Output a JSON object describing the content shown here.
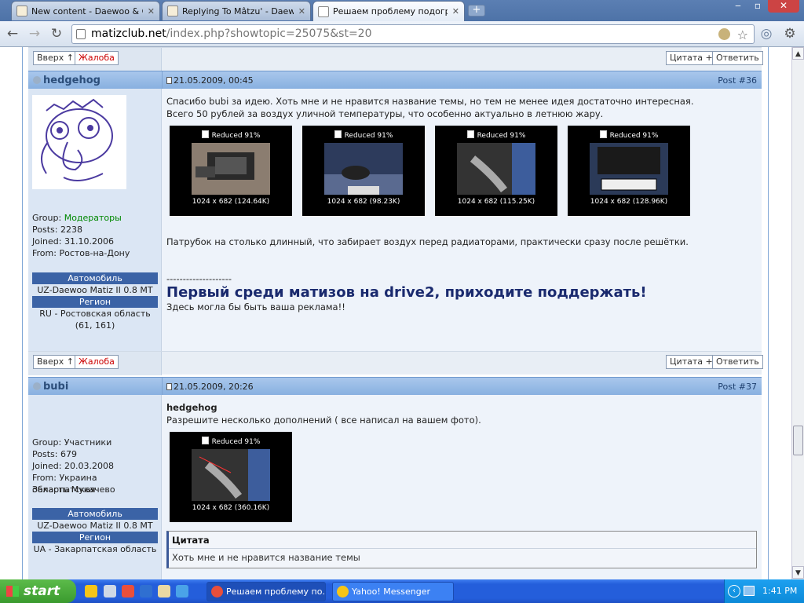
{
  "browser": {
    "tabs": [
      {
        "title": "New content - Daewoo & C..."
      },
      {
        "title": "Replying To Mâtzu' - Daew..."
      },
      {
        "title": "Решаем проблему подогр..."
      }
    ],
    "new_tab": "+",
    "url_host": "matizclub.net",
    "url_path": "/index.php?showtopic=25075&st=20",
    "window": {
      "minimize": "‒",
      "maximize": "▫",
      "close": "✕"
    }
  },
  "buttons": {
    "top": "Вверх ↑",
    "complain": "Жалоба",
    "quote": "Цитата +",
    "reply": "Ответить"
  },
  "post1": {
    "author": "hedgehog",
    "date": "21.05.2009, 00:45",
    "number": "Post #36",
    "group_label": "Group:",
    "group": "Модераторы",
    "posts": "Posts: 2238",
    "joined": "Joined: 31.10.2006",
    "from": "From: Ростов-на-Дону",
    "car_head": "Автомобиль",
    "car": "UZ-Daewoo Matiz II 0.8 MT",
    "region_head": "Регион",
    "region": "RU - Ростовская область (61, 161)",
    "text1": "Спасибо bubi за идею. Хоть мне и не нравится название темы, но тем не менее идея достаточно интересная.",
    "text2": "Всего 50 рублей за воздух уличной температуры, что особенно актуально в летнюю жару.",
    "thumbs": [
      {
        "caption": "Reduced 91%",
        "size": "1024 x 682 (124.64K)"
      },
      {
        "caption": "Reduced 91%",
        "size": "1024 x 682 (98.23K)"
      },
      {
        "caption": "Reduced 91%",
        "size": "1024 x 682 (115.25K)"
      },
      {
        "caption": "Reduced 91%",
        "size": "1024 x 682 (128.96K)"
      }
    ],
    "text3": "Патрубок на столько длинный, что забирает воздух перед радиаторами, практически сразу после решётки.",
    "sig_divider": "--------------------",
    "sig_title": "Первый среди матизов на drive2, приходите поддержать!",
    "sig_text": "Здесь могла бы быть ваша реклама!!"
  },
  "post2": {
    "author": "bubi",
    "date": "21.05.2009, 20:26",
    "number": "Post #37",
    "group": "Group: Участники",
    "posts": "Posts: 679",
    "joined": "Joined: 20.03.2008",
    "from1": "From: Украина Закарпатская",
    "from2": "область Мукачево",
    "car_head": "Автомобиль",
    "car": "UZ-Daewoo Matiz II 0.8 MT",
    "region_head": "Регион",
    "region": "UA - Закарпатская область",
    "addressee": "hedgehog",
    "text1": "Разрешите несколько дополнений ( все написал на вашем фото).",
    "thumb": {
      "caption": "Reduced 91%",
      "size": "1024 x 682 (360.16K)"
    },
    "quote_head": "Цитата",
    "quote_text": "Хоть мне и не нравится название темы"
  },
  "taskbar": {
    "start": "start",
    "items": [
      {
        "label": "Решаем проблему по..."
      },
      {
        "label": "Yahoo! Messenger"
      }
    ],
    "time": "1:41 PM"
  },
  "colors": {
    "chrome": "#3d6399",
    "post_header": "#88b0e0",
    "section_head": "#3b63a6",
    "taskbar": "#245edb",
    "start": "#3a9a2e"
  }
}
